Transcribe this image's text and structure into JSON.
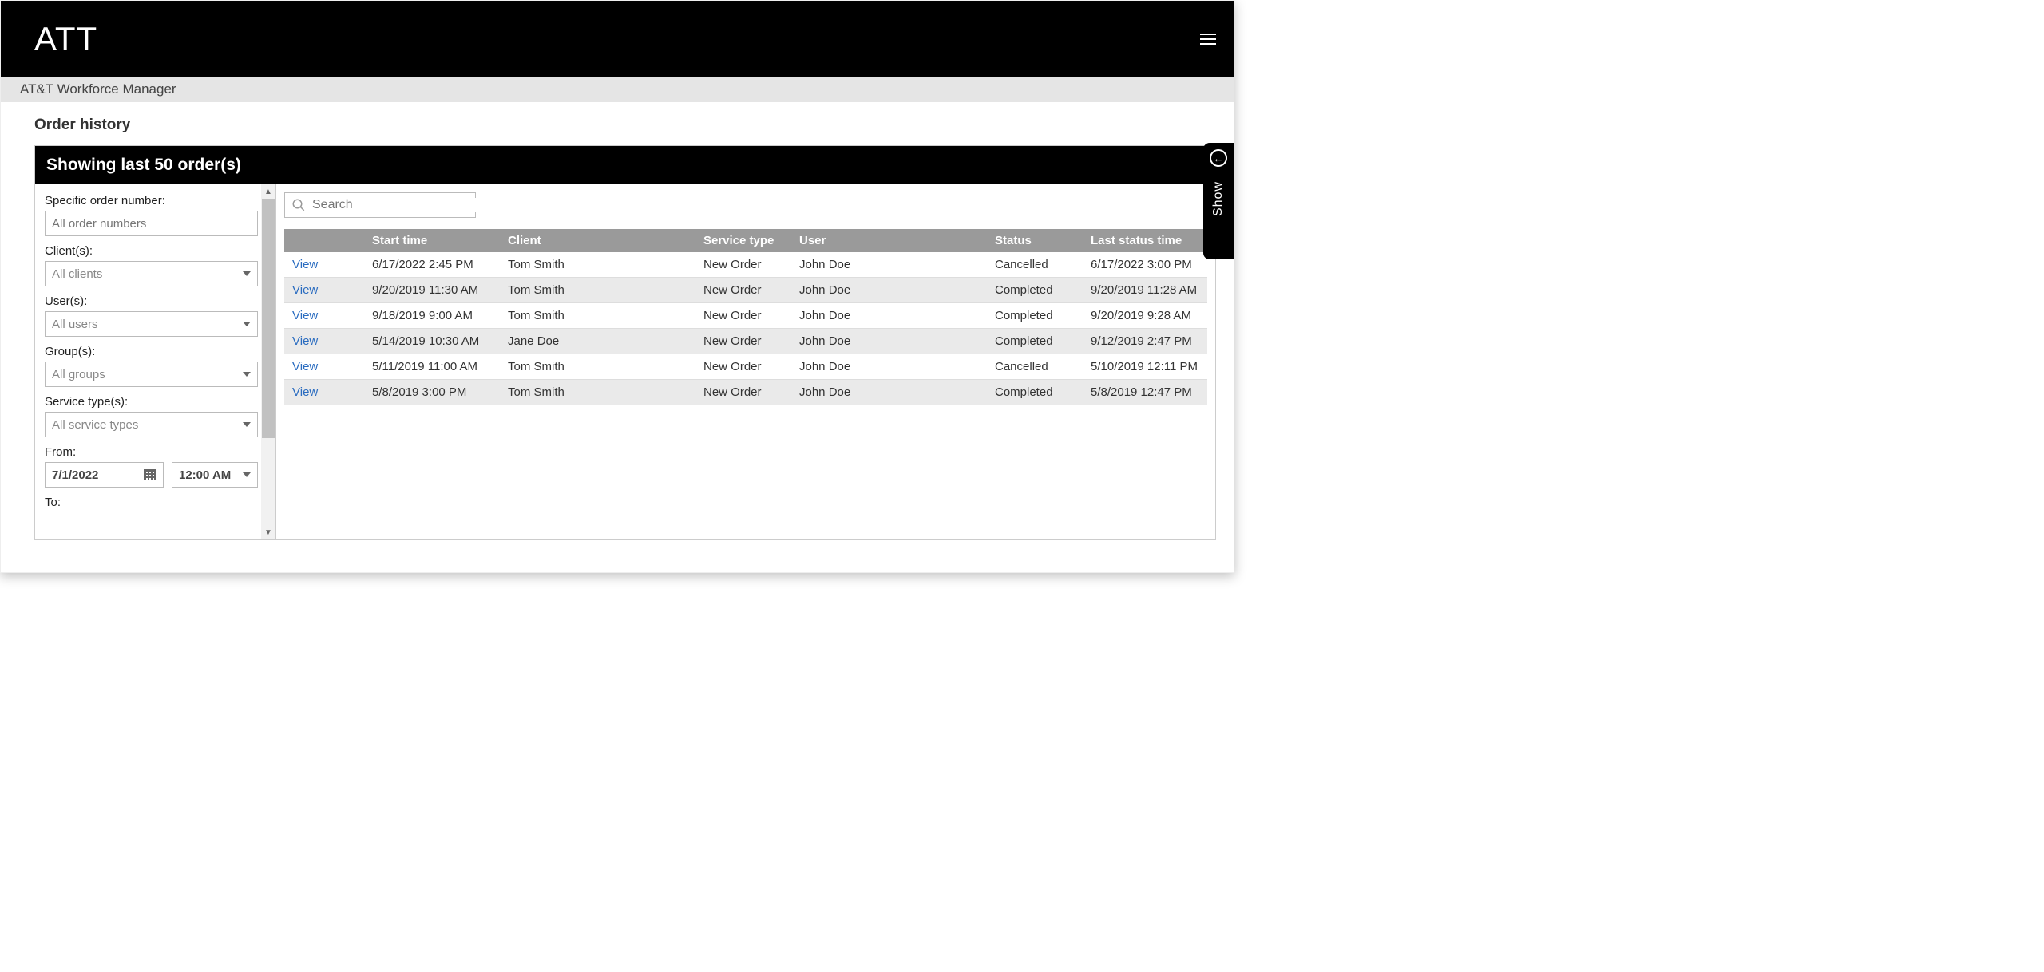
{
  "header": {
    "brand": "ATT",
    "subtitle": "AT&T Workforce Manager"
  },
  "page": {
    "title": "Order history",
    "panelTitle": "Showing last 50 order(s)"
  },
  "showTab": {
    "label": "Show"
  },
  "filters": {
    "orderNumber": {
      "label": "Specific order number:",
      "placeholder": "All order numbers"
    },
    "clients": {
      "label": "Client(s):",
      "selected": "All clients"
    },
    "users": {
      "label": "User(s):",
      "selected": "All users"
    },
    "groups": {
      "label": "Group(s):",
      "selected": "All groups"
    },
    "serviceTypes": {
      "label": "Service type(s):",
      "selected": "All service types"
    },
    "from": {
      "label": "From:",
      "date": "7/1/2022",
      "time": "12:00 AM"
    },
    "to": {
      "label": "To:"
    }
  },
  "search": {
    "placeholder": "Search"
  },
  "table": {
    "viewLabel": "View",
    "columns": {
      "start": "Start time",
      "client": "Client",
      "serviceType": "Service type",
      "user": "User",
      "status": "Status",
      "lastStatusTime": "Last status time"
    },
    "rows": [
      {
        "start": "6/17/2022 2:45 PM",
        "client": "Tom Smith",
        "serviceType": "New Order",
        "user": "John Doe",
        "status": "Cancelled",
        "lastStatusTime": "6/17/2022 3:00 PM"
      },
      {
        "start": "9/20/2019 11:30 AM",
        "client": "Tom Smith",
        "serviceType": "New Order",
        "user": "John Doe",
        "status": "Completed",
        "lastStatusTime": "9/20/2019 11:28 AM"
      },
      {
        "start": "9/18/2019 9:00 AM",
        "client": "Tom Smith",
        "serviceType": "New Order",
        "user": "John Doe",
        "status": "Completed",
        "lastStatusTime": "9/20/2019 9:28 AM"
      },
      {
        "start": "5/14/2019 10:30 AM",
        "client": "Jane Doe",
        "serviceType": "New Order",
        "user": "John Doe",
        "status": "Completed",
        "lastStatusTime": "9/12/2019 2:47 PM"
      },
      {
        "start": "5/11/2019 11:00 AM",
        "client": "Tom Smith",
        "serviceType": "New Order",
        "user": "John Doe",
        "status": "Cancelled",
        "lastStatusTime": "5/10/2019 12:11 PM"
      },
      {
        "start": "5/8/2019 3:00 PM",
        "client": "Tom Smith",
        "serviceType": "New Order",
        "user": "John Doe",
        "status": "Completed",
        "lastStatusTime": "5/8/2019 12:47 PM"
      }
    ]
  }
}
